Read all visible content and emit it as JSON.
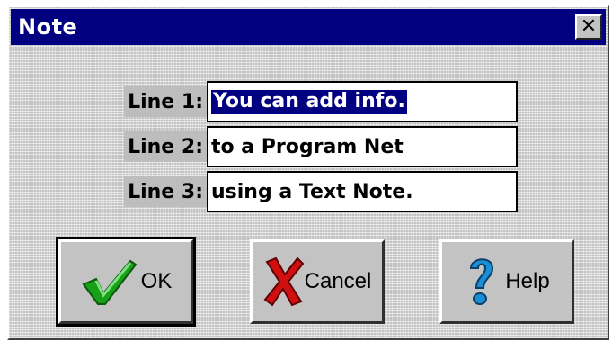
{
  "window": {
    "title": "Note",
    "close_label": "✕"
  },
  "fields": [
    {
      "label": "Line 1:",
      "value": "You can add info."
    },
    {
      "label": "Line 2:",
      "value": "to a Program Net"
    },
    {
      "label": "Line 3:",
      "value": "using a Text Note."
    }
  ],
  "buttons": {
    "ok": {
      "label": "OK",
      "icon": "checkmark-icon"
    },
    "cancel": {
      "label": "Cancel",
      "icon": "x-mark-icon"
    },
    "help": {
      "label": "Help",
      "icon": "question-mark-icon"
    }
  },
  "colors": {
    "title_bar": "#000080",
    "dialog_bg": "#c3c3c3",
    "selection": "#000080",
    "ok_icon": "#18a018",
    "cancel_icon": "#d01010",
    "help_icon": "#1a8fd6"
  }
}
